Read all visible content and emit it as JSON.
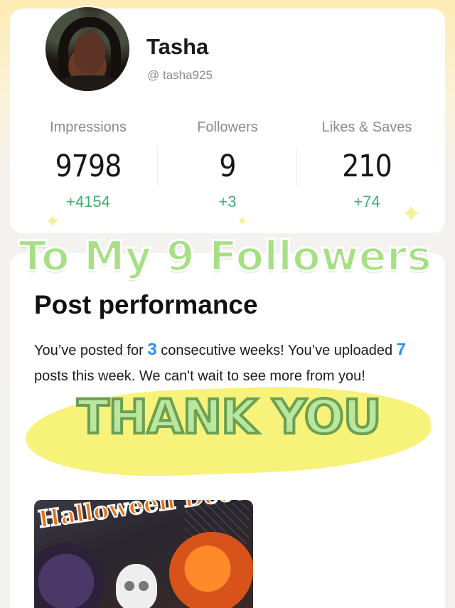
{
  "profile": {
    "name": "Tasha",
    "handle": "@ tasha925"
  },
  "stats": [
    {
      "label": "Impressions",
      "value": "9798",
      "delta": "+4154"
    },
    {
      "label": "Followers",
      "value": "9",
      "delta": "+3"
    },
    {
      "label": "Likes & Saves",
      "value": "210",
      "delta": "+74"
    }
  ],
  "overlay": {
    "title": "To My 9 Followers",
    "thank_you": "THANK YOU"
  },
  "performance": {
    "title": "Post performance",
    "text_part1": "You’ve posted for ",
    "weeks": "3",
    "text_part2": " consecutive weeks! You’ve uploaded ",
    "posts": "7",
    "text_part3": " posts this week. We can't wait to see more from you!"
  },
  "post": {
    "caption": "Halloween Decor"
  },
  "colors": {
    "delta_green": "#3fae6f",
    "number_blue": "#2a8ff0",
    "overlay_green": "#a6df84",
    "highlight_yellow": "#f6f27a"
  }
}
